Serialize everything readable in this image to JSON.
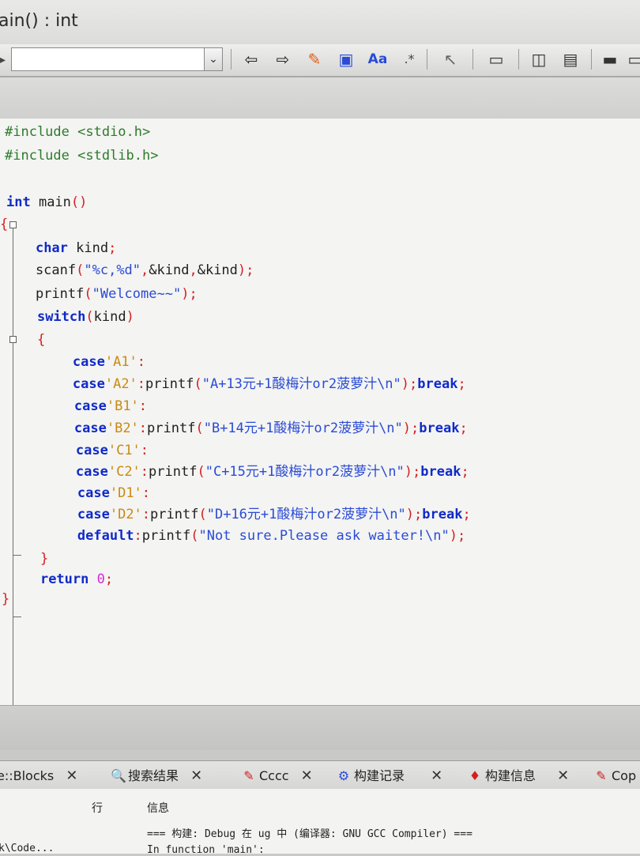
{
  "window": {
    "title_fragment": "ain() : int"
  },
  "toolbar": {
    "scope_value": "",
    "icons": [
      "arrow-left-icon",
      "arrow-right-icon",
      "highlight-icon",
      "select-icon",
      "font-icon",
      "regex-icon",
      "cursor-icon",
      "rect-icon",
      "window-icon",
      "note-icon",
      "block-icon"
    ]
  },
  "code": [
    [
      [
        "pp",
        "#include "
      ],
      [
        "hdr",
        "<stdio.h>"
      ]
    ],
    [
      [
        "pp",
        "#include "
      ],
      [
        "hdr",
        "<stdlib.h>"
      ]
    ],
    [],
    [
      [
        "kw",
        "int"
      ],
      [
        "fn",
        " main"
      ],
      [
        "op",
        "()"
      ]
    ],
    [
      [
        "op",
        "{"
      ]
    ],
    [
      [
        "fn",
        "    "
      ],
      [
        "kw",
        "char"
      ],
      [
        "fn",
        " kind"
      ],
      [
        "op",
        ";"
      ]
    ],
    [
      [
        "fn",
        "    scanf"
      ],
      [
        "op",
        "("
      ],
      [
        "str",
        "\"%c,%d\""
      ],
      [
        "op",
        ","
      ],
      [
        "fn",
        "&kind"
      ],
      [
        "op",
        ","
      ],
      [
        "fn",
        "&kind"
      ],
      [
        "op",
        ");"
      ]
    ],
    [
      [
        "fn",
        "    printf"
      ],
      [
        "op",
        "("
      ],
      [
        "str",
        "\"Welcome~~\""
      ],
      [
        "op",
        ");"
      ]
    ],
    [
      [
        "fn",
        "    "
      ],
      [
        "kw",
        "switch"
      ],
      [
        "op",
        "("
      ],
      [
        "fn",
        "kind"
      ],
      [
        "op",
        ")"
      ]
    ],
    [
      [
        "fn",
        "    "
      ],
      [
        "op",
        "{"
      ]
    ],
    [
      [
        "fn",
        "        "
      ],
      [
        "kw",
        "case"
      ],
      [
        "chr",
        "'A1'"
      ],
      [
        "op",
        ":"
      ]
    ],
    [
      [
        "fn",
        "        "
      ],
      [
        "kw",
        "case"
      ],
      [
        "chr",
        "'A2'"
      ],
      [
        "op",
        ":"
      ],
      [
        "fn",
        "printf"
      ],
      [
        "op",
        "("
      ],
      [
        "str",
        "\"A+13元+1酸梅汁or2菠萝汁\\n\""
      ],
      [
        "op",
        ");"
      ],
      [
        "kw",
        "break"
      ],
      [
        "op",
        ";"
      ]
    ],
    [
      [
        "fn",
        "        "
      ],
      [
        "kw",
        "case"
      ],
      [
        "chr",
        "'B1'"
      ],
      [
        "op",
        ":"
      ]
    ],
    [
      [
        "fn",
        "        "
      ],
      [
        "kw",
        "case"
      ],
      [
        "chr",
        "'B2'"
      ],
      [
        "op",
        ":"
      ],
      [
        "fn",
        "printf"
      ],
      [
        "op",
        "("
      ],
      [
        "str",
        "\"B+14元+1酸梅汁or2菠萝汁\\n\""
      ],
      [
        "op",
        ");"
      ],
      [
        "kw",
        "break"
      ],
      [
        "op",
        ";"
      ]
    ],
    [
      [
        "fn",
        "        "
      ],
      [
        "kw",
        "case"
      ],
      [
        "chr",
        "'C1'"
      ],
      [
        "op",
        ":"
      ]
    ],
    [
      [
        "fn",
        "        "
      ],
      [
        "kw",
        "case"
      ],
      [
        "chr",
        "'C2'"
      ],
      [
        "op",
        ":"
      ],
      [
        "fn",
        "printf"
      ],
      [
        "op",
        "("
      ],
      [
        "str",
        "\"C+15元+1酸梅汁or2菠萝汁\\n\""
      ],
      [
        "op",
        ");"
      ],
      [
        "kw",
        "break"
      ],
      [
        "op",
        ";"
      ]
    ],
    [
      [
        "fn",
        "        "
      ],
      [
        "kw",
        "case"
      ],
      [
        "chr",
        "'D1'"
      ],
      [
        "op",
        ":"
      ]
    ],
    [
      [
        "fn",
        "        "
      ],
      [
        "kw",
        "case"
      ],
      [
        "chr",
        "'D2'"
      ],
      [
        "op",
        ":"
      ],
      [
        "fn",
        "printf"
      ],
      [
        "op",
        "("
      ],
      [
        "str",
        "\"D+16元+1酸梅汁or2菠萝汁\\n\""
      ],
      [
        "op",
        ");"
      ],
      [
        "kw",
        "break"
      ],
      [
        "op",
        ";"
      ]
    ],
    [
      [
        "fn",
        "        "
      ],
      [
        "kw",
        "default"
      ],
      [
        "op",
        ":"
      ],
      [
        "fn",
        "printf"
      ],
      [
        "op",
        "("
      ],
      [
        "str",
        "\"Not sure.Please ask waiter!\\n\""
      ],
      [
        "op",
        ");"
      ]
    ],
    [
      [
        "fn",
        "    "
      ],
      [
        "op",
        "}"
      ]
    ],
    [
      [
        "fn",
        "    "
      ],
      [
        "kw",
        "return"
      ],
      [
        "fn",
        " "
      ],
      [
        "num",
        "0"
      ],
      [
        "op",
        ";"
      ]
    ],
    [
      [
        "op",
        "}"
      ]
    ]
  ],
  "log_tabs": [
    {
      "icon": "",
      "label": "e::Blocks",
      "close": "✕"
    },
    {
      "icon": "🔍",
      "label": "搜索结果",
      "close": "✕"
    },
    {
      "icon": "✎",
      "label": "Cccc",
      "close": "✕"
    },
    {
      "icon": "⚙",
      "label": "构建记录",
      "close": "✕"
    },
    {
      "icon": "♦",
      "label": "构建信息",
      "close": "✕"
    },
    {
      "icon": "✎",
      "label": "Cop",
      "close": ""
    }
  ],
  "log": {
    "col_line": "行",
    "col_message": "信息",
    "build_line": "=== 构建: Debug 在 ug 中 (编译器: GNU GCC Compiler) ===",
    "file_fragment": "k\\Code...",
    "in_function": "In function 'main':"
  },
  "colors": {
    "keyword": "#102ac8",
    "string": "#2a4bd6",
    "char": "#c98a12",
    "operator": "#d22020",
    "preproc": "#2d7a2d",
    "number": "#d62ad6"
  }
}
